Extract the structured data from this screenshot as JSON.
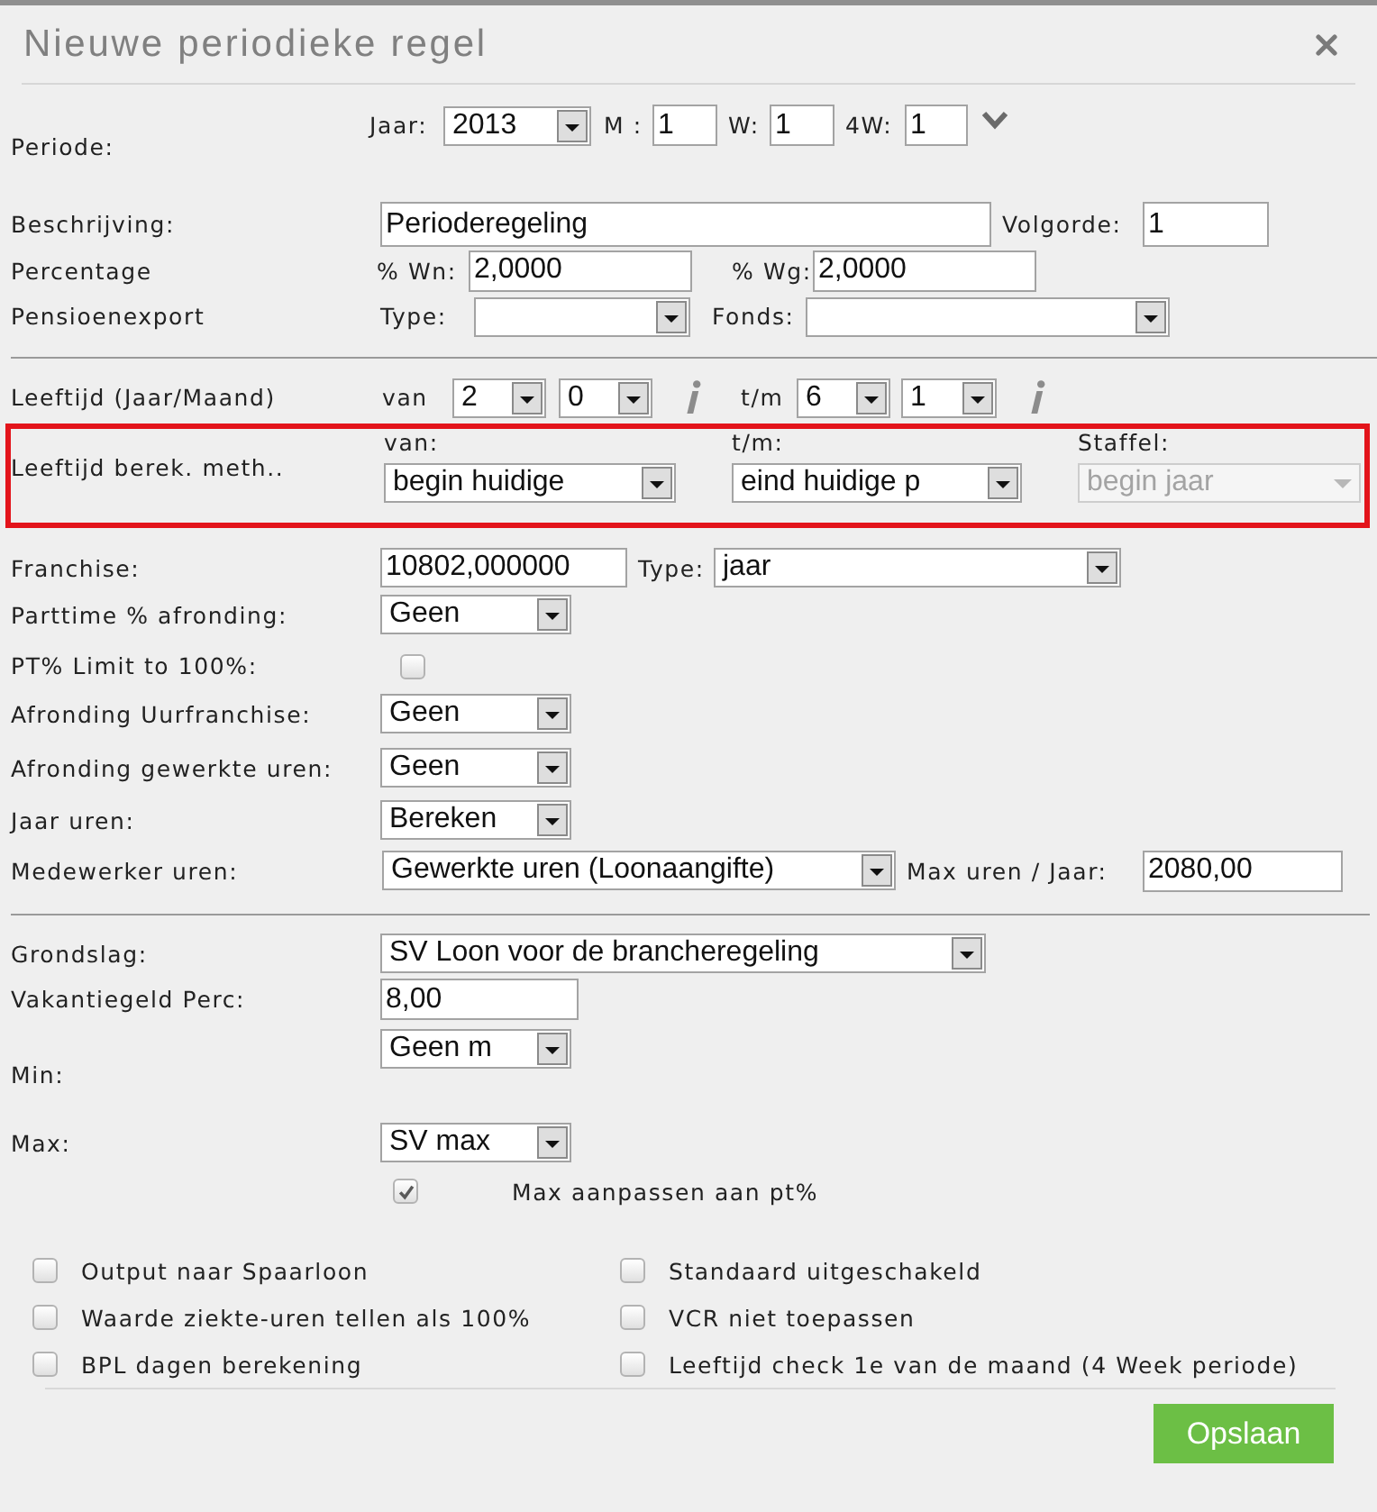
{
  "dialog_title": "Nieuwe periodieke regel",
  "periode": {
    "label": "Periode:",
    "jaar_label": "Jaar:",
    "jaar": "2013",
    "m_label": "M :",
    "m": "1",
    "w_label": "W:",
    "w": "1",
    "w4_label": "4W:",
    "w4": "1"
  },
  "beschrijving": {
    "label": "Beschrijving:",
    "value": "Perioderegeling",
    "volgorde_label": "Volgorde:",
    "volgorde": "1"
  },
  "percentage": {
    "label": "Percentage",
    "wn_label": "% Wn:",
    "wn": "2,0000",
    "wg_label": "% Wg:",
    "wg": "2,0000"
  },
  "pensioenexport": {
    "label": "Pensioenexport",
    "type_label": "Type:",
    "fonds_label": "Fonds:"
  },
  "leeftijd": {
    "label": "Leeftijd (Jaar/Maand)",
    "van_label": "van",
    "van_jaar": "2",
    "van_maand": "0",
    "tm_label": "t/m",
    "tm_jaar": "6",
    "tm_maand": "1"
  },
  "berek_meth": {
    "label": "Leeftijd berek. meth..",
    "highlighted": true,
    "van_label": "van:",
    "van": "begin huidige",
    "tm_label": "t/m:",
    "tm": "eind huidige p",
    "staffel_label": "Staffel:",
    "staffel": "begin jaar",
    "staffel_disabled": true
  },
  "franchise": {
    "label": "Franchise:",
    "value": "10802,000000",
    "type_label": "Type:",
    "type": "jaar"
  },
  "parttime_afronding": {
    "label": "Parttime % afronding:",
    "value": "Geen"
  },
  "pt_limit": {
    "label": "PT% Limit to 100%:",
    "checked": false
  },
  "afronding_uurfranchise": {
    "label": "Afronding Uurfranchise:",
    "value": "Geen"
  },
  "afronding_gewerkte_uren": {
    "label": "Afronding gewerkte uren:",
    "value": "Geen"
  },
  "jaar_uren": {
    "label": "Jaar uren:",
    "value": "Bereken"
  },
  "medewerker_uren": {
    "label": "Medewerker uren:",
    "value": "Gewerkte uren (Loonaangifte)",
    "max_label": "Max uren / Jaar:",
    "max": "2080,00"
  },
  "grondslag": {
    "label": "Grondslag:",
    "value": "SV Loon voor de brancheregeling"
  },
  "vakantiegeld": {
    "label": "Vakantiegeld Perc:",
    "value": "8,00"
  },
  "min": {
    "label": "Min:",
    "value": "Geen m"
  },
  "max": {
    "label": "Max:",
    "value": "SV max"
  },
  "max_aanpassen": {
    "label": "Max aanpassen aan pt%",
    "checked": true
  },
  "options": [
    {
      "label": "Output naar Spaarloon",
      "checked": false
    },
    {
      "label": "Standaard uitgeschakeld",
      "checked": false
    },
    {
      "label": "Waarde ziekte-uren tellen als 100%",
      "checked": false
    },
    {
      "label": "VCR niet toepassen",
      "checked": false
    },
    {
      "label": "BPL dagen berekening",
      "checked": false
    },
    {
      "label": "Leeftijd check 1e van de maand (4 Week periode)",
      "checked": false
    }
  ],
  "save_button": "Opslaan"
}
